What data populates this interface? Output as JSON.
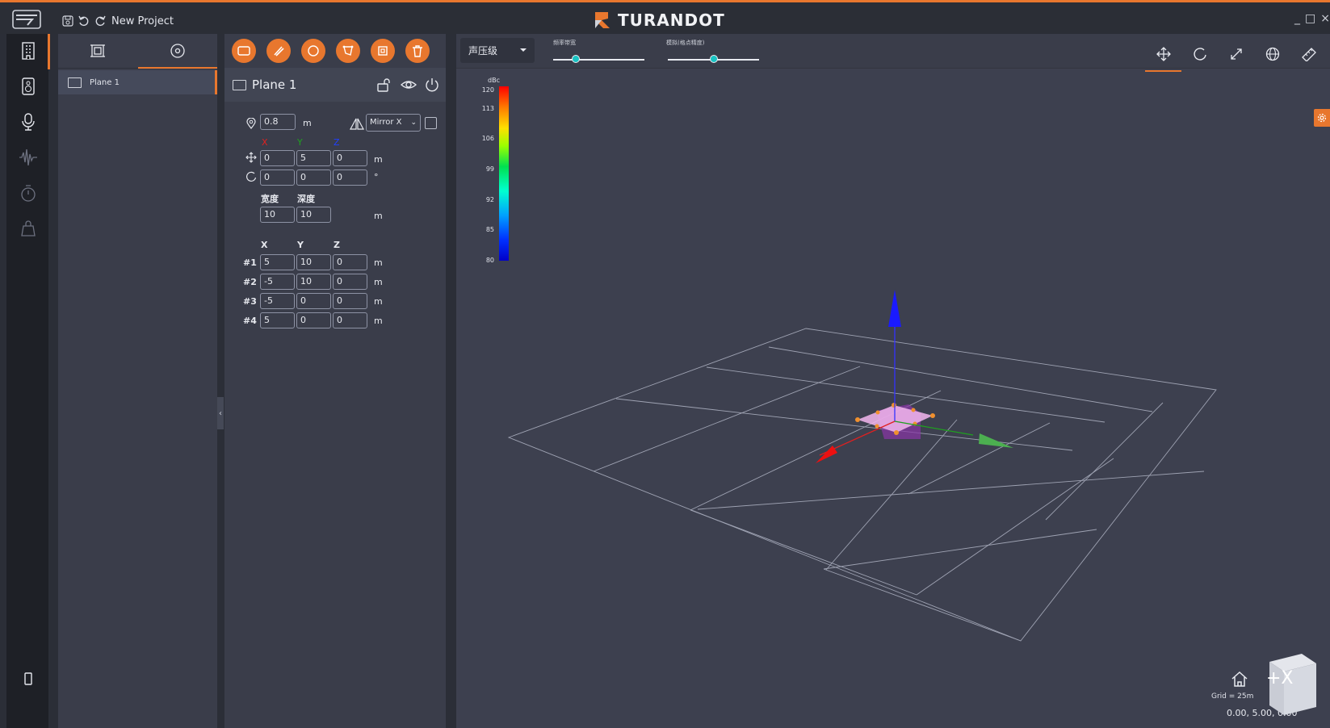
{
  "title_bar": {
    "project_name": "New Project",
    "brand": "TURANDOT",
    "accent": "#e8772e"
  },
  "side_rail": {
    "icons": [
      "building-icon",
      "speaker-icon",
      "microphone-icon",
      "waveform-icon",
      "timer-icon",
      "bag-icon",
      "phone-icon"
    ]
  },
  "object_tree": {
    "tabs": [
      "objects-tab-icon",
      "target-tab-icon"
    ],
    "items": [
      {
        "label": "Plane 1"
      }
    ]
  },
  "properties": {
    "toolbar_icons": [
      "rectangle-icon",
      "brush-icon",
      "circle-icon",
      "polygon-icon",
      "frame-icon",
      "trash-icon"
    ],
    "object_name": "Plane 1",
    "height_value": "0.8",
    "height_unit": "m",
    "mirror_option": "Mirror X",
    "axis_headers": {
      "x": "X",
      "y": "Y",
      "z": "Z"
    },
    "axis_colors": {
      "x": "#e02020",
      "y": "#20a020",
      "z": "#2040ff"
    },
    "position": {
      "x": "0",
      "y": "5",
      "z": "0",
      "unit": "m"
    },
    "rotation": {
      "x": "0",
      "y": "0",
      "z": "0",
      "unit": "°"
    },
    "size_labels": {
      "width": "宽度",
      "depth": "深度"
    },
    "size": {
      "width": "10",
      "depth": "10",
      "unit": "m"
    },
    "vertex_headers": {
      "x": "X",
      "y": "Y",
      "z": "Z"
    },
    "vertices": [
      {
        "label": "#1",
        "x": "5",
        "y": "10",
        "z": "0",
        "unit": "m"
      },
      {
        "label": "#2",
        "x": "-5",
        "y": "10",
        "z": "0",
        "unit": "m"
      },
      {
        "label": "#3",
        "x": "-5",
        "y": "0",
        "z": "0",
        "unit": "m"
      },
      {
        "label": "#4",
        "x": "5",
        "y": "0",
        "z": "0",
        "unit": "m"
      }
    ]
  },
  "viewport": {
    "mode_select": "声压级",
    "slider1_label": "频率带宽",
    "slider1_value": 0.25,
    "slider2_label": "模拟(格点精度)",
    "slider2_value": 0.5,
    "view_tools": [
      "move-icon",
      "rotate-icon",
      "scale-icon",
      "globe-icon",
      "ruler-icon"
    ],
    "legend_unit": "dBc",
    "legend_ticks": [
      "120",
      "113",
      "106",
      "99",
      "92",
      "85",
      "80"
    ],
    "grid_label": "Grid = 25m",
    "coords": "0.00, 5.00, 0.00",
    "cube_face": "+X"
  }
}
